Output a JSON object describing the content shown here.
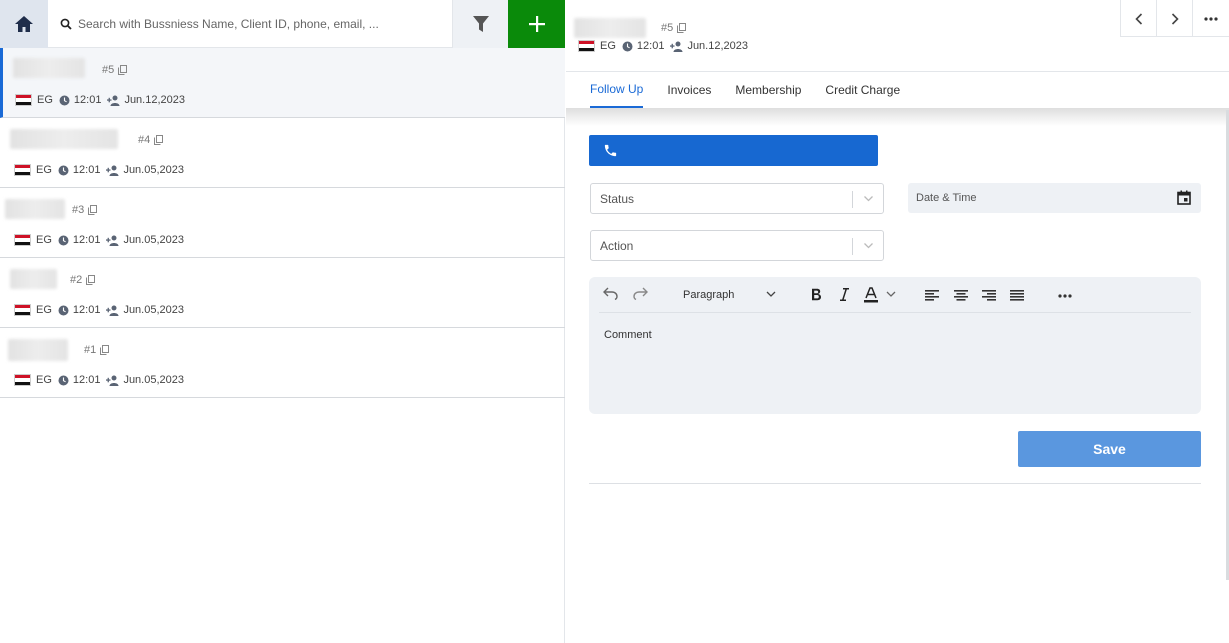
{
  "search": {
    "placeholder": "Search with Bussniess Name, Client ID, phone, email, ..."
  },
  "colors": {
    "add_button": "#0a8a0a",
    "accent": "#1a6ad6",
    "call_bar": "#1768d1",
    "save_button": "#5a97df"
  },
  "list_items": [
    {
      "num": "#5",
      "country": "EG",
      "time": "12:01",
      "date": "Jun.12,2023",
      "active": true
    },
    {
      "num": "#4",
      "country": "EG",
      "time": "12:01",
      "date": "Jun.05,2023"
    },
    {
      "num": "#3",
      "country": "EG",
      "time": "12:01",
      "date": "Jun.05,2023"
    },
    {
      "num": "#2",
      "country": "EG",
      "time": "12:01",
      "date": "Jun.05,2023"
    },
    {
      "num": "#1",
      "country": "EG",
      "time": "12:01",
      "date": "Jun.05,2023"
    }
  ],
  "detail": {
    "num": "#5",
    "country": "EG",
    "time": "12:01",
    "date": "Jun.12,2023",
    "tabs": [
      "Follow Up",
      "Invoices",
      "Membership",
      "Credit Charge"
    ],
    "status_placeholder": "Status",
    "date_placeholder": "Date & Time",
    "action_placeholder": "Action",
    "paragraph_label": "Paragraph",
    "comment_placeholder": "Comment",
    "save_label": "Save"
  }
}
